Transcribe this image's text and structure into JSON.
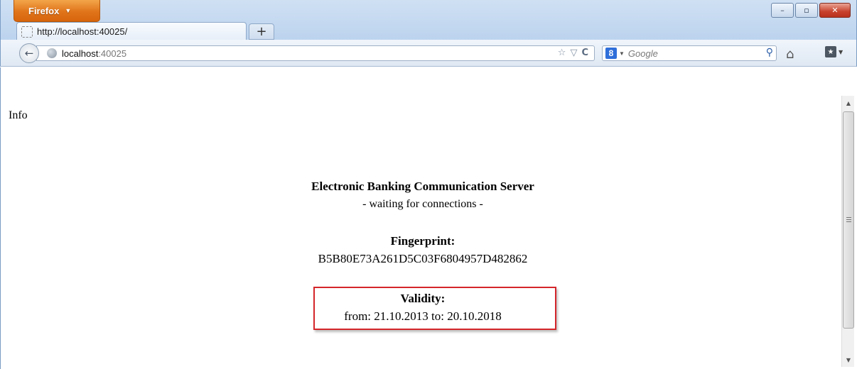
{
  "window": {
    "menu_button": "Firefox",
    "menu_caret": "▼",
    "minimize": "–",
    "restore": "▫",
    "close": "✕"
  },
  "tab": {
    "title": "http://localhost:40025/",
    "new_tab": "+"
  },
  "navbar": {
    "back": "←",
    "url_host": "localhost",
    "url_port": ":40025",
    "bookmark_star": "☆",
    "dropdown": "▽",
    "reload": "C",
    "search_engine": "8",
    "search_placeholder": "Google",
    "search_go": "⚲",
    "home": "⌂",
    "bookmarks": "★"
  },
  "page": {
    "heading": "Info",
    "server_title": "Electronic Banking Communication Server",
    "server_status": "- waiting for connections -",
    "fingerprint_label": "Fingerprint:",
    "fingerprint_value": "B5B80E73A261D5C03F6804957D482862",
    "validity_label": "Validity:",
    "validity_value": "from: 21.10.2013 to: 20.10.2018"
  },
  "colors": {
    "highlight_border": "#d4262b",
    "firefox_button": "#e0741a"
  }
}
